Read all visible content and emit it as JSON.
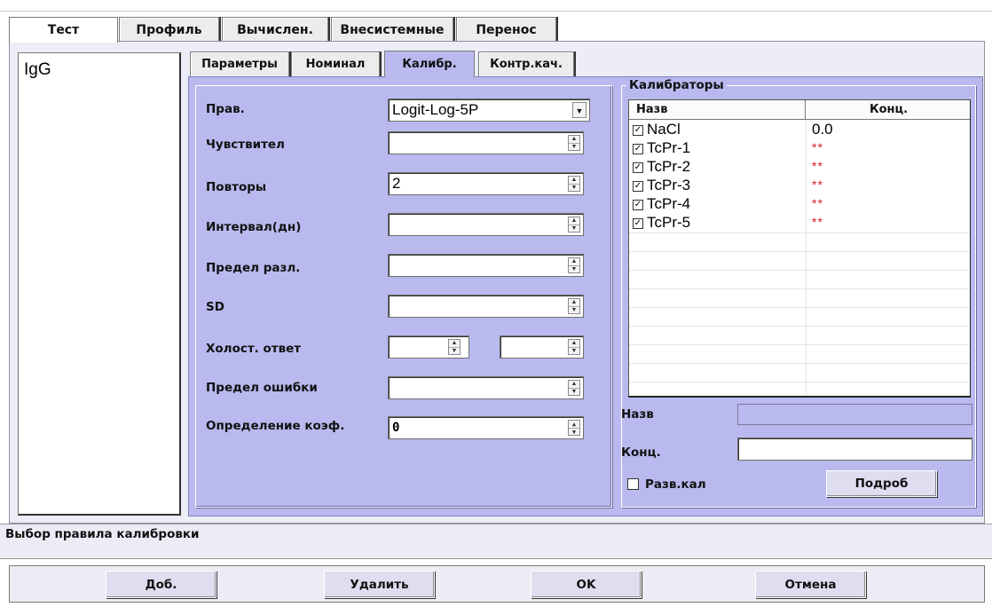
{
  "main_tabs": [
    "Тест",
    "Профиль",
    "Вычислен.",
    "Внесистемные",
    "Перенос"
  ],
  "tests": [
    "IgG"
  ],
  "sub_tabs": [
    "Параметры",
    "Номинал",
    "Калибр.",
    "Контр.кач."
  ],
  "form": {
    "rule_label": "Прав.",
    "rule_value": "Logit-Log-5P",
    "sensitivity_label": "Чувствител",
    "sensitivity_value": "",
    "repeats_label": "Повторы",
    "repeats_value": "2",
    "interval_label": "Интервал(дн)",
    "interval_value": "",
    "limit_diff_label": "Предел разл.",
    "limit_diff_value": "",
    "sd_label": "SD",
    "sd_value": "",
    "blank_label": "Холост. ответ",
    "blank_value_1": "",
    "blank_value_2": "",
    "error_limit_label": "Предел ошибки",
    "error_limit_value": "",
    "coef_label": "Определение коэф.",
    "coef_value": "0"
  },
  "calibrators": {
    "title": "Калибраторы",
    "col_name": "Назв",
    "col_conc": "Конц.",
    "rows": [
      {
        "name": "NaCl",
        "conc": "0.0",
        "checked": true
      },
      {
        "name": "TcPr-1",
        "conc": "**",
        "checked": true
      },
      {
        "name": "TcPr-2",
        "conc": "**",
        "checked": true
      },
      {
        "name": "TcPr-3",
        "conc": "**",
        "checked": true
      },
      {
        "name": "TcPr-4",
        "conc": "**",
        "checked": true
      },
      {
        "name": "TcPr-5",
        "conc": "**",
        "checked": true
      }
    ],
    "name_label": "Назв",
    "name_value": "",
    "conc_label": "Конц.",
    "conc_value": "",
    "dilution_label": "Разв.кал",
    "details_button": "Подроб"
  },
  "status_text": "Выбор правила калибровки",
  "buttons": {
    "add": "Доб.",
    "delete": "Удалить",
    "ok": "OK",
    "cancel": "Отмена"
  },
  "colors": {
    "panel": "#b9b9ef",
    "missing_value": "#d42020"
  }
}
